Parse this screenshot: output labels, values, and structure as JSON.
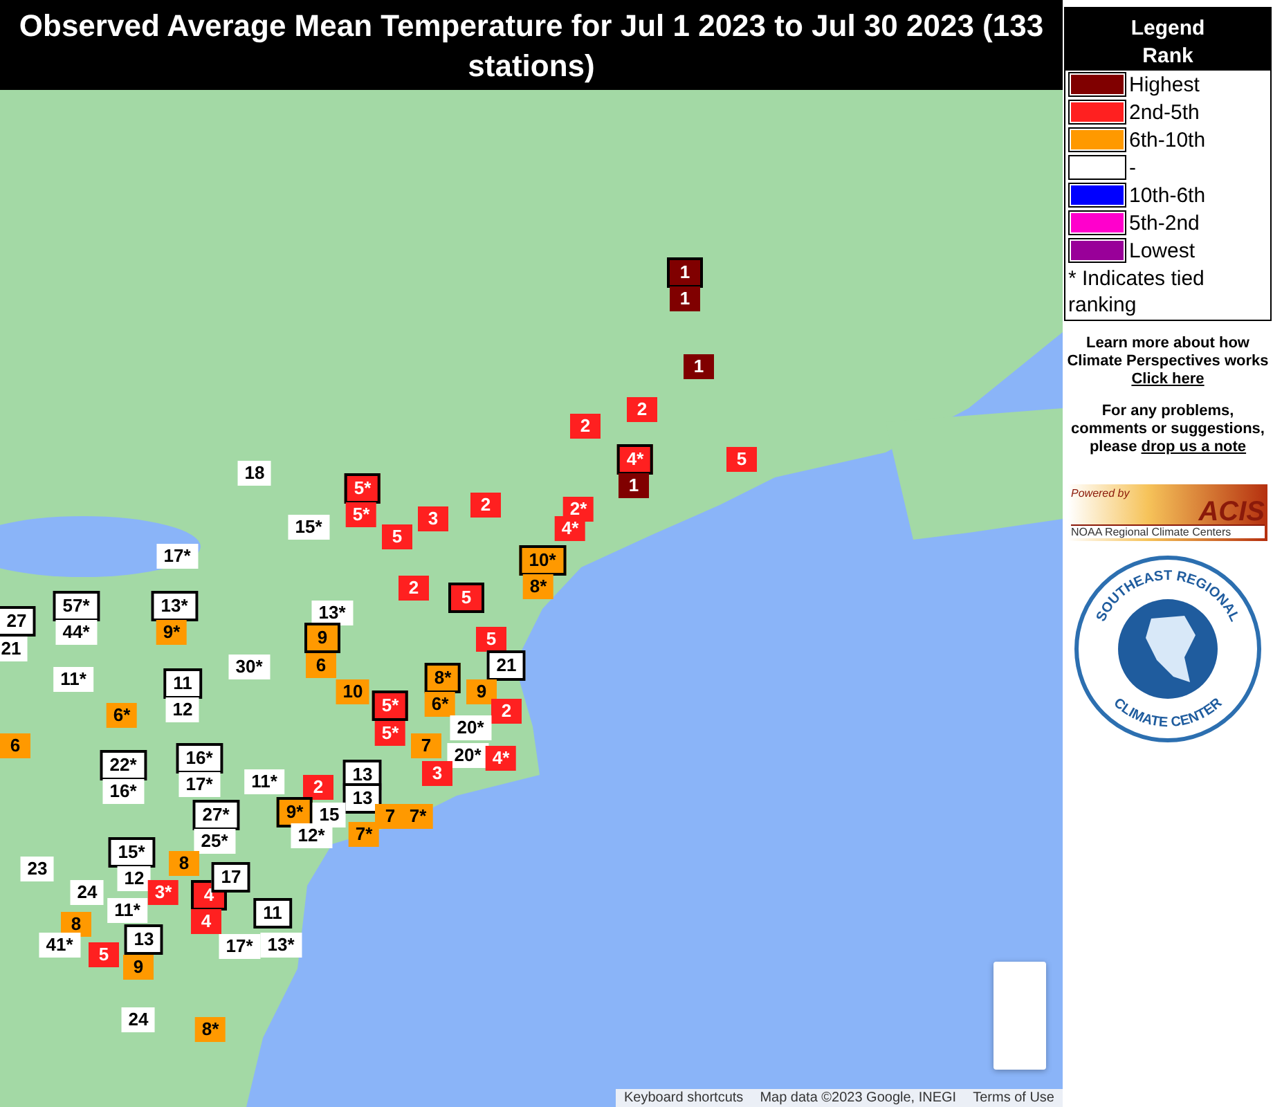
{
  "title": "Observed Average Mean Temperature for Jul 1 2023 to Jul 30 2023 (133 stations)",
  "legend": {
    "title": "Legend",
    "subtitle": "Rank",
    "items": [
      {
        "label": "Highest",
        "color": "#800000"
      },
      {
        "label": "2nd-5th",
        "color": "#ff2020"
      },
      {
        "label": "6th-10th",
        "color": "#ff9900"
      },
      {
        "label": "-",
        "color": "#ffffff"
      },
      {
        "label": "10th-6th",
        "color": "#0000ff"
      },
      {
        "label": "5th-2nd",
        "color": "#ff00cc"
      },
      {
        "label": "Lowest",
        "color": "#990099"
      }
    ],
    "note": "* Indicates tied ranking"
  },
  "info": [
    {
      "text": "Learn more about how Climate Perspectives works",
      "link": "Click here"
    },
    {
      "text": "For any problems, comments or suggestions, please",
      "link": "drop us a note"
    }
  ],
  "acis_logo": {
    "tagline": "Powered by",
    "name": "ACIS",
    "subtitle": "NOAA Regional Climate Centers"
  },
  "sercc_logo": {
    "top": "SOUTHEAST REGIONAL",
    "bottom": "CLIMATE CENTER"
  },
  "markers": [
    {
      "label": "1",
      "color": "#800000",
      "outlined": true
    },
    {
      "label": "1",
      "color": "#800000",
      "outlined": false
    },
    {
      "label": "1",
      "color": "#800000",
      "outlined": false
    },
    {
      "label": "2",
      "color": "#ff2020",
      "outlined": false
    },
    {
      "label": "2",
      "color": "#ff2020",
      "outlined": false
    },
    {
      "label": "4*",
      "color": "#ff2020",
      "outlined": true
    },
    {
      "label": "1",
      "color": "#800000",
      "outlined": false
    },
    {
      "label": "5",
      "color": "#ff2020",
      "outlined": false
    },
    {
      "label": "2*",
      "color": "#ff2020",
      "outlined": false
    },
    {
      "label": "4*",
      "color": "#ff2020",
      "outlined": false
    },
    {
      "label": "10*",
      "color": "#ff9900",
      "outlined": true
    },
    {
      "label": "8*",
      "color": "#ff9900",
      "outlined": false
    },
    {
      "label": "5*",
      "color": "#ff2020",
      "outlined": true
    },
    {
      "label": "5*",
      "color": "#ff2020",
      "outlined": false
    },
    {
      "label": "3",
      "color": "#ff2020",
      "outlined": false
    },
    {
      "label": "5",
      "color": "#ff2020",
      "outlined": false
    },
    {
      "label": "2",
      "color": "#ff2020",
      "outlined": false
    },
    {
      "label": "15*",
      "color": "#ffffff",
      "outlined": false
    },
    {
      "label": "18",
      "color": "#ffffff",
      "outlined": false
    },
    {
      "label": "17*",
      "color": "#ffffff",
      "outlined": false
    },
    {
      "label": "2",
      "color": "#ff2020",
      "outlined": false
    },
    {
      "label": "5",
      "color": "#ff2020",
      "outlined": true
    },
    {
      "label": "5",
      "color": "#ff2020",
      "outlined": false
    },
    {
      "label": "13*",
      "color": "#ffffff",
      "outlined": false
    },
    {
      "label": "9",
      "color": "#ff9900",
      "outlined": true
    },
    {
      "label": "6",
      "color": "#ff9900",
      "outlined": false
    },
    {
      "label": "8*",
      "color": "#ff9900",
      "outlined": true
    },
    {
      "label": "21",
      "color": "#ffffff",
      "outlined": true
    },
    {
      "label": "10",
      "color": "#ff9900",
      "outlined": false
    },
    {
      "label": "5*",
      "color": "#ff2020",
      "outlined": true
    },
    {
      "label": "6*",
      "color": "#ff9900",
      "outlined": false
    },
    {
      "label": "9",
      "color": "#ff9900",
      "outlined": false
    },
    {
      "label": "2",
      "color": "#ff2020",
      "outlined": false
    },
    {
      "label": "5*",
      "color": "#ff2020",
      "outlined": false
    },
    {
      "label": "7",
      "color": "#ff9900",
      "outlined": false
    },
    {
      "label": "20*",
      "color": "#ffffff",
      "outlined": false
    },
    {
      "label": "20*",
      "color": "#ffffff",
      "outlined": false
    },
    {
      "label": "4*",
      "color": "#ff2020",
      "outlined": false
    },
    {
      "label": "11*",
      "color": "#ffffff",
      "outlined": false
    },
    {
      "label": "2",
      "color": "#ff2020",
      "outlined": false
    },
    {
      "label": "13",
      "color": "#ffffff",
      "outlined": true
    },
    {
      "label": "13",
      "color": "#ffffff",
      "outlined": true
    },
    {
      "label": "3",
      "color": "#ff2020",
      "outlined": false
    },
    {
      "label": "9*",
      "color": "#ff9900",
      "outlined": true
    },
    {
      "label": "15",
      "color": "#ffffff",
      "outlined": false
    },
    {
      "label": "7",
      "color": "#ff9900",
      "outlined": false
    },
    {
      "label": "7*",
      "color": "#ff9900",
      "outlined": false
    },
    {
      "label": "12*",
      "color": "#ffffff",
      "outlined": false
    },
    {
      "label": "7*",
      "color": "#ff9900",
      "outlined": false
    },
    {
      "label": "27",
      "color": "#ffffff",
      "outlined": true
    },
    {
      "label": "21",
      "color": "#ffffff",
      "outlined": false
    },
    {
      "label": "57*",
      "color": "#ffffff",
      "outlined": true
    },
    {
      "label": "44*",
      "color": "#ffffff",
      "outlined": false
    },
    {
      "label": "13*",
      "color": "#ffffff",
      "outlined": true
    },
    {
      "label": "9*",
      "color": "#ff9900",
      "outlined": false
    },
    {
      "label": "11*",
      "color": "#ffffff",
      "outlined": false
    },
    {
      "label": "11",
      "color": "#ffffff",
      "outlined": true
    },
    {
      "label": "30*",
      "color": "#ffffff",
      "outlined": false
    },
    {
      "label": "6*",
      "color": "#ff9900",
      "outlined": false
    },
    {
      "label": "12",
      "color": "#ffffff",
      "outlined": false
    },
    {
      "label": "6",
      "color": "#ff9900",
      "outlined": false
    },
    {
      "label": "22*",
      "color": "#ffffff",
      "outlined": true
    },
    {
      "label": "16*",
      "color": "#ffffff",
      "outlined": false
    },
    {
      "label": "16*",
      "color": "#ffffff",
      "outlined": true
    },
    {
      "label": "17*",
      "color": "#ffffff",
      "outlined": false
    },
    {
      "label": "27*",
      "color": "#ffffff",
      "outlined": true
    },
    {
      "label": "15*",
      "color": "#ffffff",
      "outlined": true
    },
    {
      "label": "25*",
      "color": "#ffffff",
      "outlined": false
    },
    {
      "label": "12",
      "color": "#ffffff",
      "outlined": false
    },
    {
      "label": "8",
      "color": "#ff9900",
      "outlined": false
    },
    {
      "label": "3*",
      "color": "#ff2020",
      "outlined": false
    },
    {
      "label": "4",
      "color": "#ff2020",
      "outlined": true
    },
    {
      "label": "17",
      "color": "#ffffff",
      "outlined": true
    },
    {
      "label": "11*",
      "color": "#ffffff",
      "outlined": false
    },
    {
      "label": "4",
      "color": "#ff2020",
      "outlined": false
    },
    {
      "label": "11",
      "color": "#ffffff",
      "outlined": true
    },
    {
      "label": "23",
      "color": "#ffffff",
      "outlined": false
    },
    {
      "label": "24",
      "color": "#ffffff",
      "outlined": false
    },
    {
      "label": "8",
      "color": "#ff9900",
      "outlined": false
    },
    {
      "label": "41*",
      "color": "#ffffff",
      "outlined": false
    },
    {
      "label": "5",
      "color": "#ff2020",
      "outlined": false
    },
    {
      "label": "13",
      "color": "#ffffff",
      "outlined": true
    },
    {
      "label": "9",
      "color": "#ff9900",
      "outlined": false
    },
    {
      "label": "17*",
      "color": "#ffffff",
      "outlined": false
    },
    {
      "label": "13*",
      "color": "#ffffff",
      "outlined": false
    },
    {
      "label": "24",
      "color": "#ffffff",
      "outlined": false
    },
    {
      "label": "8*",
      "color": "#ff9900",
      "outlined": false
    }
  ],
  "attribution": [
    "Keyboard shortcuts",
    "Map data ©2023 Google, INEGI",
    "Terms of Use"
  ]
}
